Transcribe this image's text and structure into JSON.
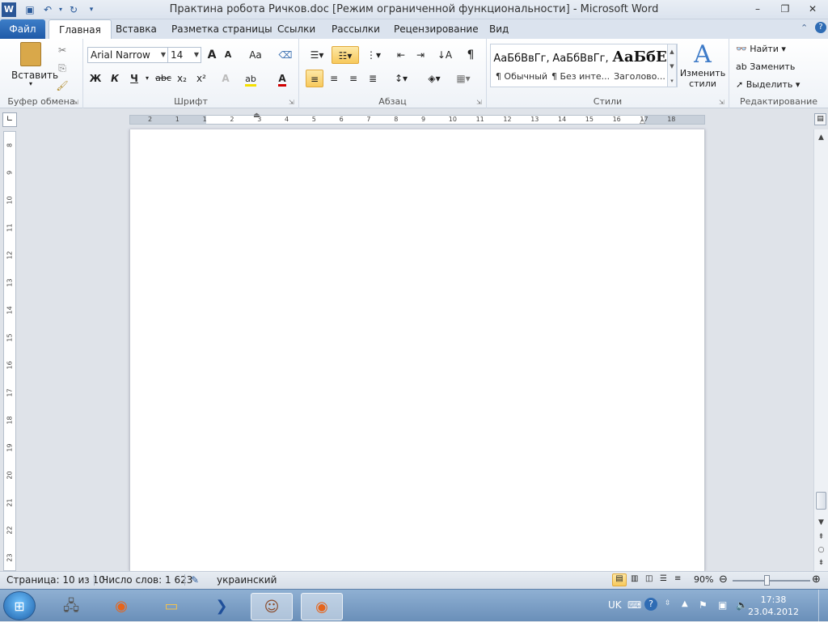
{
  "title": "Практина робота Ричков.doc [Режим ограниченной функциональности]  -  Microsoft Word",
  "qat": {
    "word_icon": "word-icon",
    "save": "save-icon",
    "undo": "undo-icon",
    "redo": "redo-icon",
    "customize": "dropdown-icon"
  },
  "window": {
    "minimize": "–",
    "maximize": "❐",
    "close": "✕"
  },
  "tabs": [
    {
      "label": "Файл"
    },
    {
      "label": "Главная"
    },
    {
      "label": "Вставка"
    },
    {
      "label": "Разметка страницы"
    },
    {
      "label": "Ссылки"
    },
    {
      "label": "Рассылки"
    },
    {
      "label": "Рецензирование"
    },
    {
      "label": "Вид"
    }
  ],
  "clipboard": {
    "paste": "Вставить",
    "label": "Буфер обмена"
  },
  "font": {
    "name": "Arial Narrow",
    "size": "14",
    "label": "Шрифт",
    "bold": "Ж",
    "italic": "К",
    "underline": "Ч",
    "strike": "abc",
    "sub": "x₂",
    "sup": "x²",
    "grow": "A",
    "shrink": "A",
    "case": "Aa"
  },
  "paragraph": {
    "label": "Абзац",
    "pilcrow": "¶"
  },
  "styles": {
    "label": "Стили",
    "items": [
      {
        "sample": "АаБбВвГг,",
        "name": "¶ Обычный"
      },
      {
        "sample": "АаБбВвГг,",
        "name": "¶ Без инте..."
      },
      {
        "sample": "АаБбЕ",
        "name": "Заголово..."
      }
    ],
    "change": "Изменить стили"
  },
  "editing": {
    "label": "Редактирование",
    "find": "Найти",
    "replace": "Заменить",
    "select": "Выделить"
  },
  "hruler_ticks": [
    "2",
    "1",
    "1",
    "2",
    "3",
    "4",
    "5",
    "6",
    "7",
    "8",
    "9",
    "10",
    "11",
    "12",
    "13",
    "14",
    "15",
    "16",
    "17",
    "18"
  ],
  "vruler_ticks": [
    "8",
    "9",
    "10",
    "11",
    "12",
    "13",
    "14",
    "15",
    "16",
    "17",
    "18",
    "19",
    "20",
    "21",
    "22",
    "23"
  ],
  "status": {
    "page": "Страница: 10 из 10",
    "words": "Число слов: 1 623",
    "language": "украинский",
    "zoom": "90%"
  },
  "tray": {
    "lang": "UK",
    "time": "17:38",
    "date": "23.04.2012"
  },
  "colors": {
    "accent": "#1f5aa8",
    "highlight": "#f7c95c",
    "font_color": "#d00000",
    "highlighter": "#f5e000"
  }
}
